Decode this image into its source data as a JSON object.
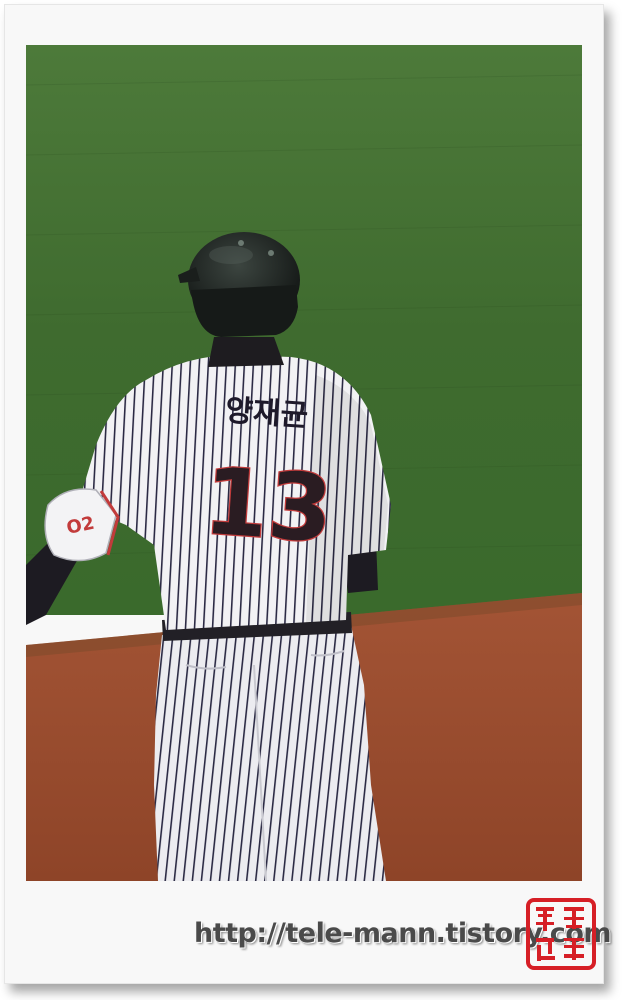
{
  "photo": {
    "subject": "baseball-player-back-view",
    "jersey_name": "양재균",
    "jersey_number": "13",
    "sleeve_logo": "O2"
  },
  "footer": {
    "url_text": "http://tele-mann.tistory.com"
  },
  "seal": {
    "color": "#d61f26"
  },
  "colors": {
    "grass": "#3f6a2e",
    "dirt": "#9a4a2c",
    "number": "#2a1c22"
  }
}
